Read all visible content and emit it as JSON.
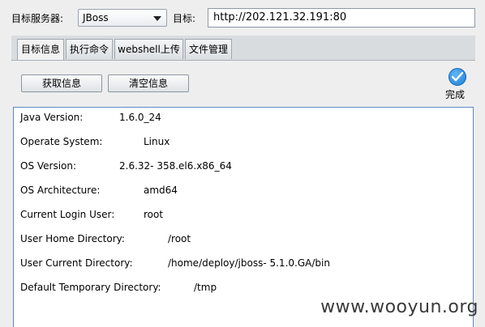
{
  "toolbar": {
    "server_label": "目标服务器:",
    "server_value": "JBoss",
    "target_label": "目标:",
    "target_value": "http://202.121.32.191:80"
  },
  "tabs": [
    {
      "label": "目标信息",
      "active": true
    },
    {
      "label": "执行命令",
      "active": false
    },
    {
      "label": "webshell上传",
      "active": false
    },
    {
      "label": "文件管理",
      "active": false
    }
  ],
  "actions": {
    "fetch_label": "获取信息",
    "clear_label": "清空信息",
    "status_label": "完成"
  },
  "info_rows": [
    {
      "key": "Java Version:",
      "value": "1.6.0_24"
    },
    {
      "key": "Operate System:",
      "value": "Linux"
    },
    {
      "key": "OS Version:",
      "value": "2.6.32- 358.el6.x86_64"
    },
    {
      "key": "OS Architecture:",
      "value": "amd64"
    },
    {
      "key": "Current Login User:",
      "value": "root"
    },
    {
      "key": "User Home Directory:",
      "value": "/root"
    },
    {
      "key": "User Current Directory:",
      "value": "/home/deploy/jboss- 5.1.0.GA/bin"
    },
    {
      "key": "Default Temporary Directory:",
      "value": "/tmp"
    }
  ],
  "watermark": "www.wooyun.org",
  "colors": {
    "panel_border": "#5b8ac4",
    "status_check": "#1f7ed6"
  }
}
